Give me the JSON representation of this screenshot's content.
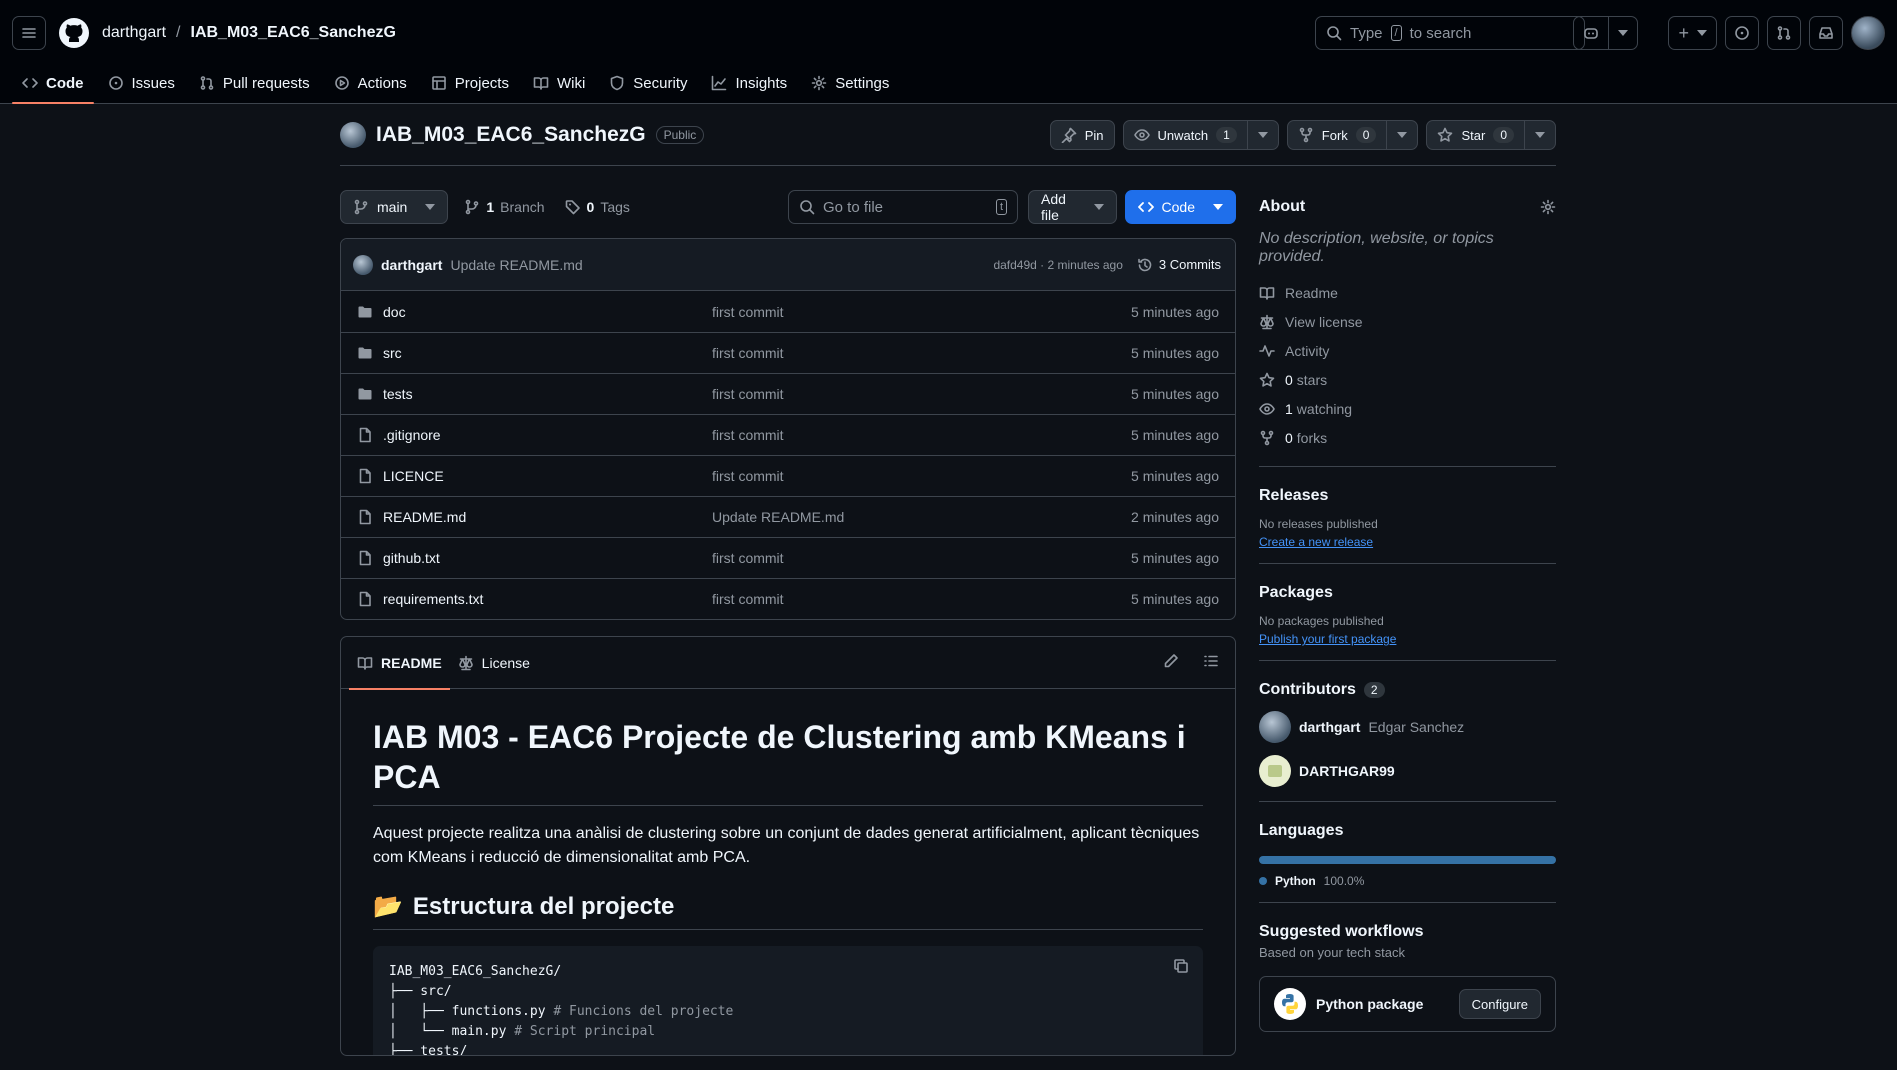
{
  "header": {
    "owner": "darthgart",
    "separator": "/",
    "repo": "IAB_M03_EAC6_SanchezG",
    "search_text_before": "Type",
    "search_key": "/",
    "search_text_after": "to search",
    "plus": "+"
  },
  "tabs": [
    {
      "label": "Code",
      "icon": "code-icon"
    },
    {
      "label": "Issues",
      "icon": "issue-icon"
    },
    {
      "label": "Pull requests",
      "icon": "pull-request-icon"
    },
    {
      "label": "Actions",
      "icon": "play-icon"
    },
    {
      "label": "Projects",
      "icon": "table-icon"
    },
    {
      "label": "Wiki",
      "icon": "book-icon"
    },
    {
      "label": "Security",
      "icon": "shield-icon"
    },
    {
      "label": "Insights",
      "icon": "graph-icon"
    },
    {
      "label": "Settings",
      "icon": "gear-icon"
    }
  ],
  "repo": {
    "title": "IAB_M03_EAC6_SanchezG",
    "visibility": "Public",
    "pin": "Pin",
    "unwatch": "Unwatch",
    "watch_count": "1",
    "fork": "Fork",
    "fork_count": "0",
    "star": "Star",
    "star_count": "0"
  },
  "toolbar": {
    "branch": "main",
    "branches_count": "1",
    "branches_label": "Branch",
    "tags_count": "0",
    "tags_label": "Tags",
    "goto_placeholder": "Go to file",
    "goto_key": "t",
    "add_file": "Add file",
    "code": "Code"
  },
  "latest_commit": {
    "author": "darthgart",
    "message": "Update README.md",
    "hash_time": "dafd49d · 2 minutes ago",
    "commits": "3 Commits"
  },
  "files": [
    {
      "name": "doc",
      "type": "folder",
      "message": "first commit",
      "time": "5 minutes ago"
    },
    {
      "name": "src",
      "type": "folder",
      "message": "first commit",
      "time": "5 minutes ago"
    },
    {
      "name": "tests",
      "type": "folder",
      "message": "first commit",
      "time": "5 minutes ago"
    },
    {
      "name": ".gitignore",
      "type": "file",
      "message": "first commit",
      "time": "5 minutes ago"
    },
    {
      "name": "LICENCE",
      "type": "file",
      "message": "first commit",
      "time": "5 minutes ago"
    },
    {
      "name": "README.md",
      "type": "file",
      "message": "Update README.md",
      "time": "2 minutes ago"
    },
    {
      "name": "github.txt",
      "type": "file",
      "message": "first commit",
      "time": "5 minutes ago"
    },
    {
      "name": "requirements.txt",
      "type": "file",
      "message": "first commit",
      "time": "5 minutes ago"
    }
  ],
  "readme": {
    "tab_readme": "README",
    "tab_license": "License",
    "h1": "IAB M03 - EAC6 Projecte de Clustering amb KMeans i PCA",
    "paragraph": "Aquest projecte realitza una anàlisi de clustering sobre un conjunt de dades generat artificialment, aplicant tècniques com KMeans i reducció de dimensionalitat amb PCA.",
    "h2_emoji": "📂",
    "h2": "Estructura del projecte",
    "code_lines": [
      {
        "text": "IAB_M03_EAC6_SanchezG/",
        "comment": ""
      },
      {
        "text": "├── src/",
        "comment": ""
      },
      {
        "text": "│   ├── functions.py",
        "comment": " # Funcions del projecte"
      },
      {
        "text": "│   └── main.py",
        "comment": " # Script principal"
      },
      {
        "text": "├── tests/",
        "comment": ""
      }
    ]
  },
  "about": {
    "title": "About",
    "description": "No description, website, or topics provided.",
    "links": [
      {
        "icon": "book-icon",
        "count": "",
        "label": "Readme"
      },
      {
        "icon": "law-icon",
        "count": "",
        "label": "View license"
      },
      {
        "icon": "pulse-icon",
        "count": "",
        "label": "Activity"
      },
      {
        "icon": "star-icon",
        "count": "0",
        "label": "stars"
      },
      {
        "icon": "eye-icon",
        "count": "1",
        "label": "watching"
      },
      {
        "icon": "fork-icon",
        "count": "0",
        "label": "forks"
      }
    ]
  },
  "releases": {
    "title": "Releases",
    "none": "No releases published",
    "link": "Create a new release"
  },
  "packages": {
    "title": "Packages",
    "none": "No packages published",
    "link": "Publish your first package"
  },
  "contributors": {
    "title": "Contributors",
    "count": "2",
    "list": [
      {
        "login": "darthgart",
        "name": "Edgar Sanchez"
      },
      {
        "login": "DARTHGAR99",
        "name": ""
      }
    ]
  },
  "languages": {
    "title": "Languages",
    "name": "Python",
    "percent": "100.0%",
    "color": "#3572a5"
  },
  "workflows": {
    "title": "Suggested workflows",
    "subtitle": "Based on your tech stack",
    "item": "Python package",
    "configure": "Configure"
  },
  "colors": {
    "accent": "#1f6feb",
    "tab_underline": "#f78166",
    "link": "#4493f8",
    "background": "#0d1117"
  }
}
